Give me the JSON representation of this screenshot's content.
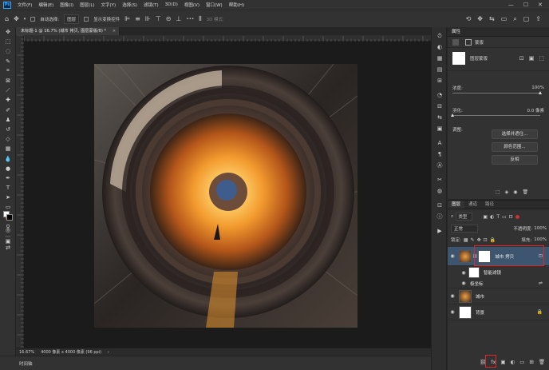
{
  "menubar": {
    "logo": "Ps",
    "items": [
      "文件(F)",
      "编辑(E)",
      "图像(I)",
      "图层(L)",
      "文字(Y)",
      "选择(S)",
      "滤镜(T)",
      "3D(D)",
      "视图(V)",
      "窗口(W)",
      "帮助(H)"
    ],
    "window_controls": [
      "—",
      "☐",
      "✕"
    ]
  },
  "options_bar": {
    "auto_select_label": "自动选择:",
    "auto_select_value": "图层",
    "show_transform_label": "显示变换控件",
    "mode_3d": "3D 模式:",
    "more": "•••"
  },
  "document": {
    "tab_title": "未标题-1 @ 16.7% (城市 拷贝, 图层蒙版/8) *",
    "close": "×"
  },
  "status_bar": {
    "zoom": "16.67%",
    "doc_size": "4000 像素 x 4000 像素 (96 ppi)",
    "arrow": "›"
  },
  "timeline": {
    "label": "时间轴"
  },
  "properties": {
    "panel_title": "属性",
    "mask_header": "蒙版",
    "mask_type": "图层蒙版",
    "density_label": "浓度:",
    "density_value": "100%",
    "feather_label": "羽化:",
    "feather_value": "0.0 像素",
    "refine_label": "调整:",
    "select_mask_btn": "选择并遮住...",
    "color_range_btn": "颜色范围...",
    "invert_btn": "反相"
  },
  "layers": {
    "tabs": [
      "图层",
      "通道",
      "路径"
    ],
    "filter_kind": "类型",
    "blend_mode": "正常",
    "opacity_label": "不透明度:",
    "opacity_value": "100%",
    "lock_label": "锁定:",
    "fill_label": "填充:",
    "fill_value": "100%",
    "items": [
      {
        "name": "城市 拷贝",
        "selected": true
      },
      {
        "name": "智能滤镜"
      },
      {
        "name": "极坐标"
      },
      {
        "name": "城市"
      },
      {
        "name": "背景"
      }
    ]
  },
  "colors": {
    "highlight_red": "#e0252b",
    "selected_layer": "#3e5570",
    "ps_blue": "#31a8ff"
  }
}
